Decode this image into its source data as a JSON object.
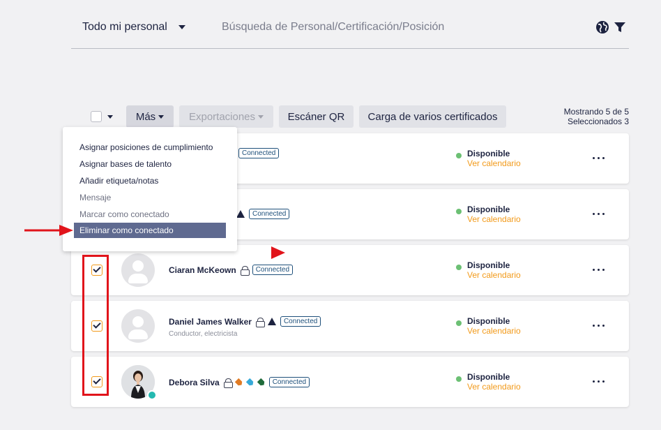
{
  "header": {
    "scope_label": "Todo mi personal",
    "search_placeholder": "Búsqueda de Personal/Certificación/Posición"
  },
  "toolbar": {
    "more_label": "Más",
    "exports_label": "Exportaciones",
    "qr_label": "Escáner QR",
    "bulk_label": "Carga de varios certificados",
    "showing": "Mostrando 5 de 5",
    "selected": "Seleccionados 3"
  },
  "menu": {
    "items": [
      {
        "label": "Asignar posiciones de cumplimiento",
        "state": "enabled"
      },
      {
        "label": "Asignar bases de talento",
        "state": "enabled"
      },
      {
        "label": "Añadir etiqueta/notas",
        "state": "enabled"
      },
      {
        "label": "Mensaje",
        "state": "disabled"
      },
      {
        "label": "Marcar como conectado",
        "state": "disabled"
      },
      {
        "label": "Eliminar como conectado",
        "state": "highlighted"
      }
    ]
  },
  "rows": [
    {
      "name": "",
      "badge": "Connected",
      "subtitle": "",
      "status": "Disponible",
      "calendar": "Ver calendario",
      "checked": false
    },
    {
      "name": "",
      "badge": "Connected",
      "subtitle": "",
      "status": "Disponible",
      "calendar": "Ver calendario",
      "checked": false
    },
    {
      "name": "Ciaran McKeown",
      "badge": "Connected",
      "subtitle": "",
      "status": "Disponible",
      "calendar": "Ver calendario",
      "checked": true
    },
    {
      "name": "Daniel James Walker",
      "badge": "Connected",
      "subtitle": "Conductor, electricista",
      "status": "Disponible",
      "calendar": "Ver calendario",
      "checked": true
    },
    {
      "name": "Debora Silva",
      "badge": "Connected",
      "subtitle": "",
      "status": "Disponible",
      "calendar": "Ver calendario",
      "checked": true
    }
  ],
  "colors": {
    "accent": "#f29a1a",
    "available": "#6cc074",
    "menu_highlight": "#5f6a90",
    "annotation": "#e1141b",
    "tag_colors": [
      "#e07b24",
      "#37a9d8",
      "#1f6b3a"
    ]
  }
}
